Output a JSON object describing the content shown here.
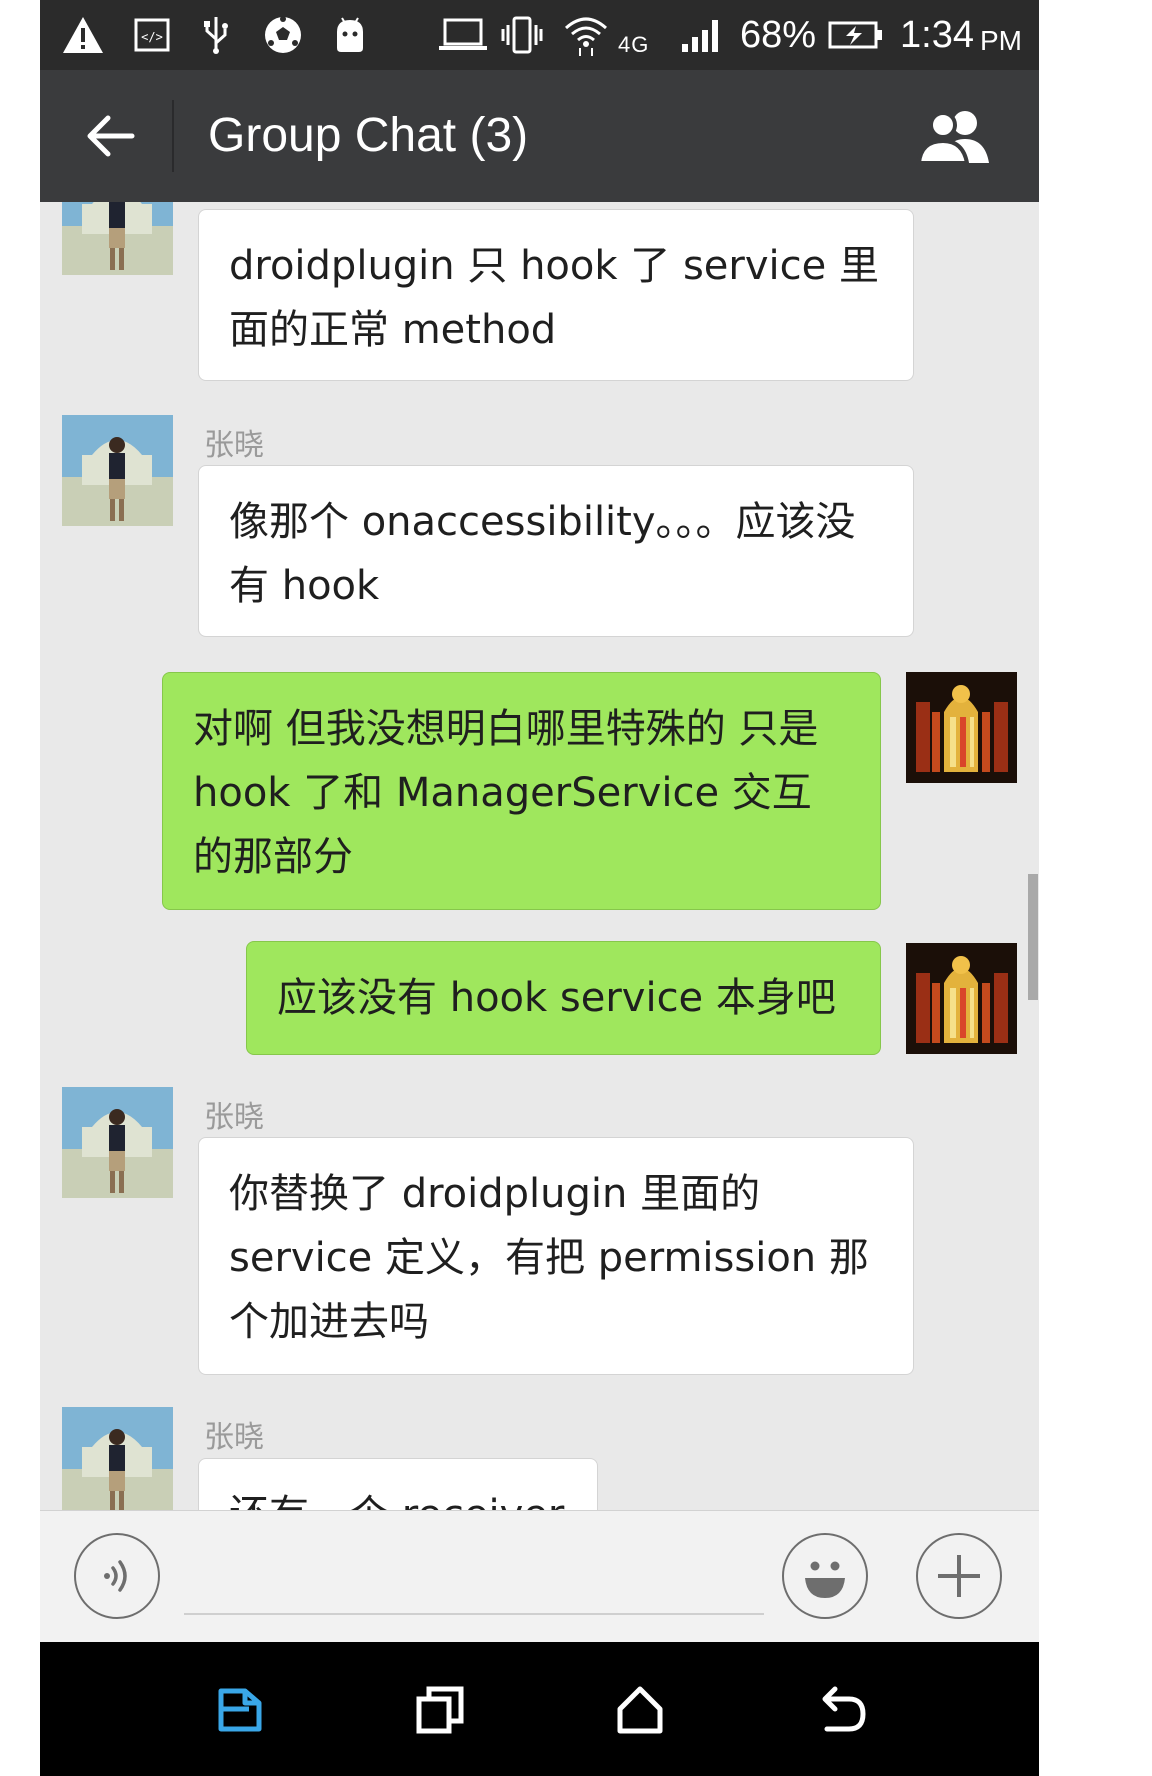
{
  "status_bar": {
    "battery_text": "68%",
    "time_text": "1:34",
    "ampm_text": "PM",
    "network_text": "4G"
  },
  "header": {
    "title": "Group Chat (3)"
  },
  "messages": [
    {
      "side": "in",
      "sender": "",
      "text": "droidplugin 只 hook 了 service 里面的正常 method"
    },
    {
      "side": "in",
      "sender": "张晓",
      "text": "像那个 onaccessibility。。。应该没有 hook"
    },
    {
      "side": "out",
      "sender": "",
      "text": "对啊 但我没想明白哪里特殊的 只是 hook 了和 ManagerService 交互的那部分"
    },
    {
      "side": "out",
      "sender": "",
      "text": "应该没有 hook service 本身吧"
    },
    {
      "side": "in",
      "sender": "张晓",
      "text": "你替换了 droidplugin 里面的 service 定义，有把 permission 那个加进去吗"
    },
    {
      "side": "in",
      "sender": "张晓",
      "text": "还有一个 receiver"
    }
  ],
  "input_bar": {
    "text_value": ""
  },
  "colors": {
    "status_bar_bg": "#2b2b2b",
    "header_bg": "#3a3b3d",
    "chat_bg": "#e9e9e9",
    "incoming_bubble": "#ffffff",
    "outgoing_bubble": "#9fe75d",
    "nav_bar_bg": "#000000",
    "nav_highlight": "#3aa7e8"
  },
  "icons": {
    "status": [
      "warning-icon",
      "code-icon",
      "usb-icon",
      "soccer-ball-icon",
      "android-icon",
      "laptop-icon",
      "vibrate-icon",
      "wifi-icon",
      "signal-icon",
      "battery-charging-icon"
    ],
    "header": [
      "back-arrow-icon",
      "group-members-icon"
    ],
    "input": [
      "voice-icon",
      "emoji-icon",
      "plus-icon"
    ],
    "nav": [
      "app-switch-icon",
      "recent-apps-icon",
      "home-icon",
      "back-icon"
    ]
  }
}
